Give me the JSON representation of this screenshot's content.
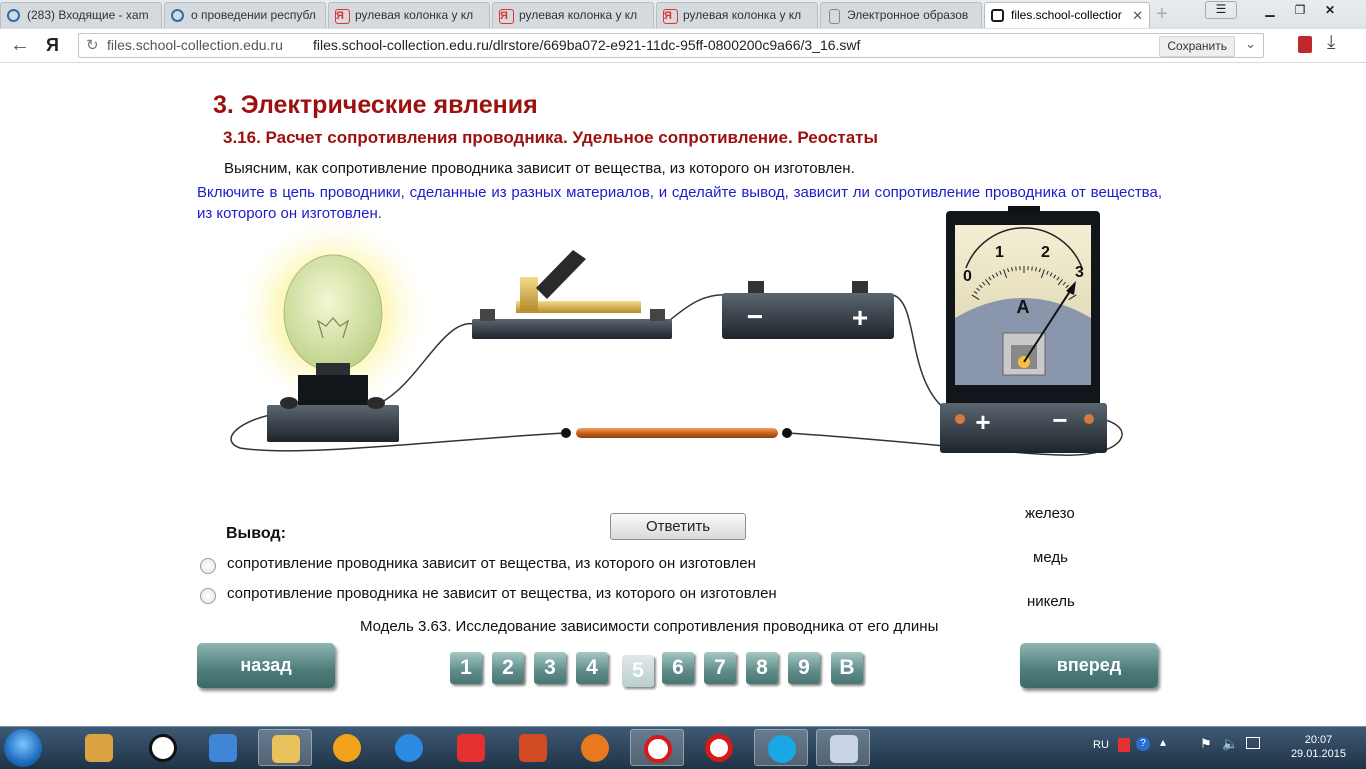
{
  "tabs": [
    {
      "label": "(283) Входящие - xam",
      "icon_color": "#2b6db0"
    },
    {
      "label": "о проведении республ",
      "icon_color": "#2b6db0"
    },
    {
      "label": "рулевая колонка у кл",
      "icon_color": "#e53030"
    },
    {
      "label": "рулевая колонка у кл",
      "icon_color": "#e53030"
    },
    {
      "label": "рулевая колонка у кл",
      "icon_color": "#e53030"
    },
    {
      "label": "Электронное образов",
      "icon_color": "#888888"
    },
    {
      "label": "files.school-collectior",
      "icon_color": "#1a1a1a"
    }
  ],
  "browser": {
    "back_icon": "back-arrow-icon",
    "brand": "Я",
    "host": "files.school-collection.edu.ru",
    "url": "files.school-collection.edu.ru/dlrstore/669ba072-e921-11dc-95ff-0800200c9a66/3_16.swf",
    "save_label": "Сохранить"
  },
  "lesson": {
    "title": "3. Электрические явления",
    "subtitle": "3.16. Расчет сопротивления проводника. Удельное сопротивление. Реостаты",
    "intro": "Выясним, как сопротивление проводника зависит от вещества, из которого он изготовлен.",
    "task": "Включите в цепь проводники, сделанные из разных материалов, и сделайте вывод, зависит ли сопротивление проводника от вещества, из которого он изготовлен.",
    "conclusion_label": "Вывод:",
    "option1": "сопротивление проводника зависит от вещества, из которого он изготовлен",
    "option2": "сопротивление проводника не зависит от вещества, из которого он изготовлен",
    "answer_button": "Ответить",
    "caption": "Модель 3.63. Исследование зависимости сопротивления проводника от его длины",
    "materials": [
      "железо",
      "медь",
      "никель"
    ]
  },
  "ammeter": {
    "letter": "A",
    "scale": [
      "0",
      "1",
      "2",
      "3"
    ],
    "plus": "+",
    "minus": "−"
  },
  "battery": {
    "minus": "−",
    "plus": "+"
  },
  "nav": {
    "back": "назад",
    "forward": "вперед",
    "pages": [
      "1",
      "2",
      "3",
      "4",
      "5",
      "6",
      "7",
      "8",
      "9",
      "B"
    ],
    "current_page": "5"
  },
  "taskbar": {
    "lang": "RU",
    "time": "20:07",
    "date": "29.01.2015"
  },
  "colors": {
    "heading": "#9d1010",
    "task_text": "#1d1dc8",
    "nav_button": "#4d7d79"
  }
}
